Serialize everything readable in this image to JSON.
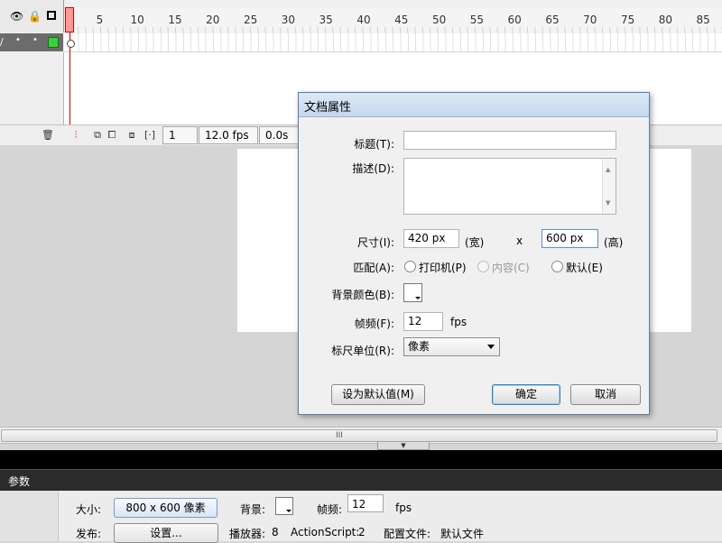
{
  "timeline": {
    "ruler_ticks": [
      "1",
      "5",
      "10",
      "15",
      "20",
      "25",
      "30",
      "35",
      "40",
      "45",
      "50",
      "55",
      "60",
      "65",
      "70",
      "75",
      "80",
      "85"
    ],
    "current_frame": "1",
    "frame_rate": "12.0 fps",
    "elapsed_time": "0.0s"
  },
  "dialog": {
    "title": "文档属性",
    "title_label": "标题(T):",
    "title_value": "",
    "description_label": "描述(D):",
    "description_value": "",
    "size_label": "尺寸(I):",
    "width_value": "420 px",
    "width_unit": "(宽)",
    "times": "x",
    "height_value": "600 px",
    "height_unit": "(高)",
    "match_label": "匹配(A):",
    "match_options": [
      {
        "label": "打印机(P)",
        "enabled": true,
        "selected": false
      },
      {
        "label": "内容(C)",
        "enabled": false,
        "selected": false
      },
      {
        "label": "默认(E)",
        "enabled": true,
        "selected": false
      }
    ],
    "bg_color_label": "背景颜色(B):",
    "bg_color": "#ffffff",
    "fps_label": "帧频(F):",
    "fps_value": "12",
    "fps_unit": "fps",
    "ruler_unit_label": "标尺单位(R):",
    "ruler_unit_value": "像素",
    "make_default_button": "设为默认值(M)",
    "ok_button": "确定",
    "cancel_button": "取消"
  },
  "properties": {
    "header": "参数",
    "size_label": "大小:",
    "size_button": "800 x 600 像素",
    "background_label": "背景:",
    "fps_label": "帧频:",
    "fps_value": "12",
    "fps_unit": "fps",
    "publish_label": "发布:",
    "settings_button": "设置...",
    "player_label": "播放器:",
    "player_value": "8",
    "actionscript_label": "ActionScript:",
    "actionscript_value": "2",
    "profile_label": "配置文件:",
    "profile_value": "默认文件"
  },
  "colors": {
    "playhead": "#d40000",
    "dialog_border": "#5d7ea6",
    "layer_row": "#6c6c6c",
    "panel_header": "#2b2b2b"
  }
}
